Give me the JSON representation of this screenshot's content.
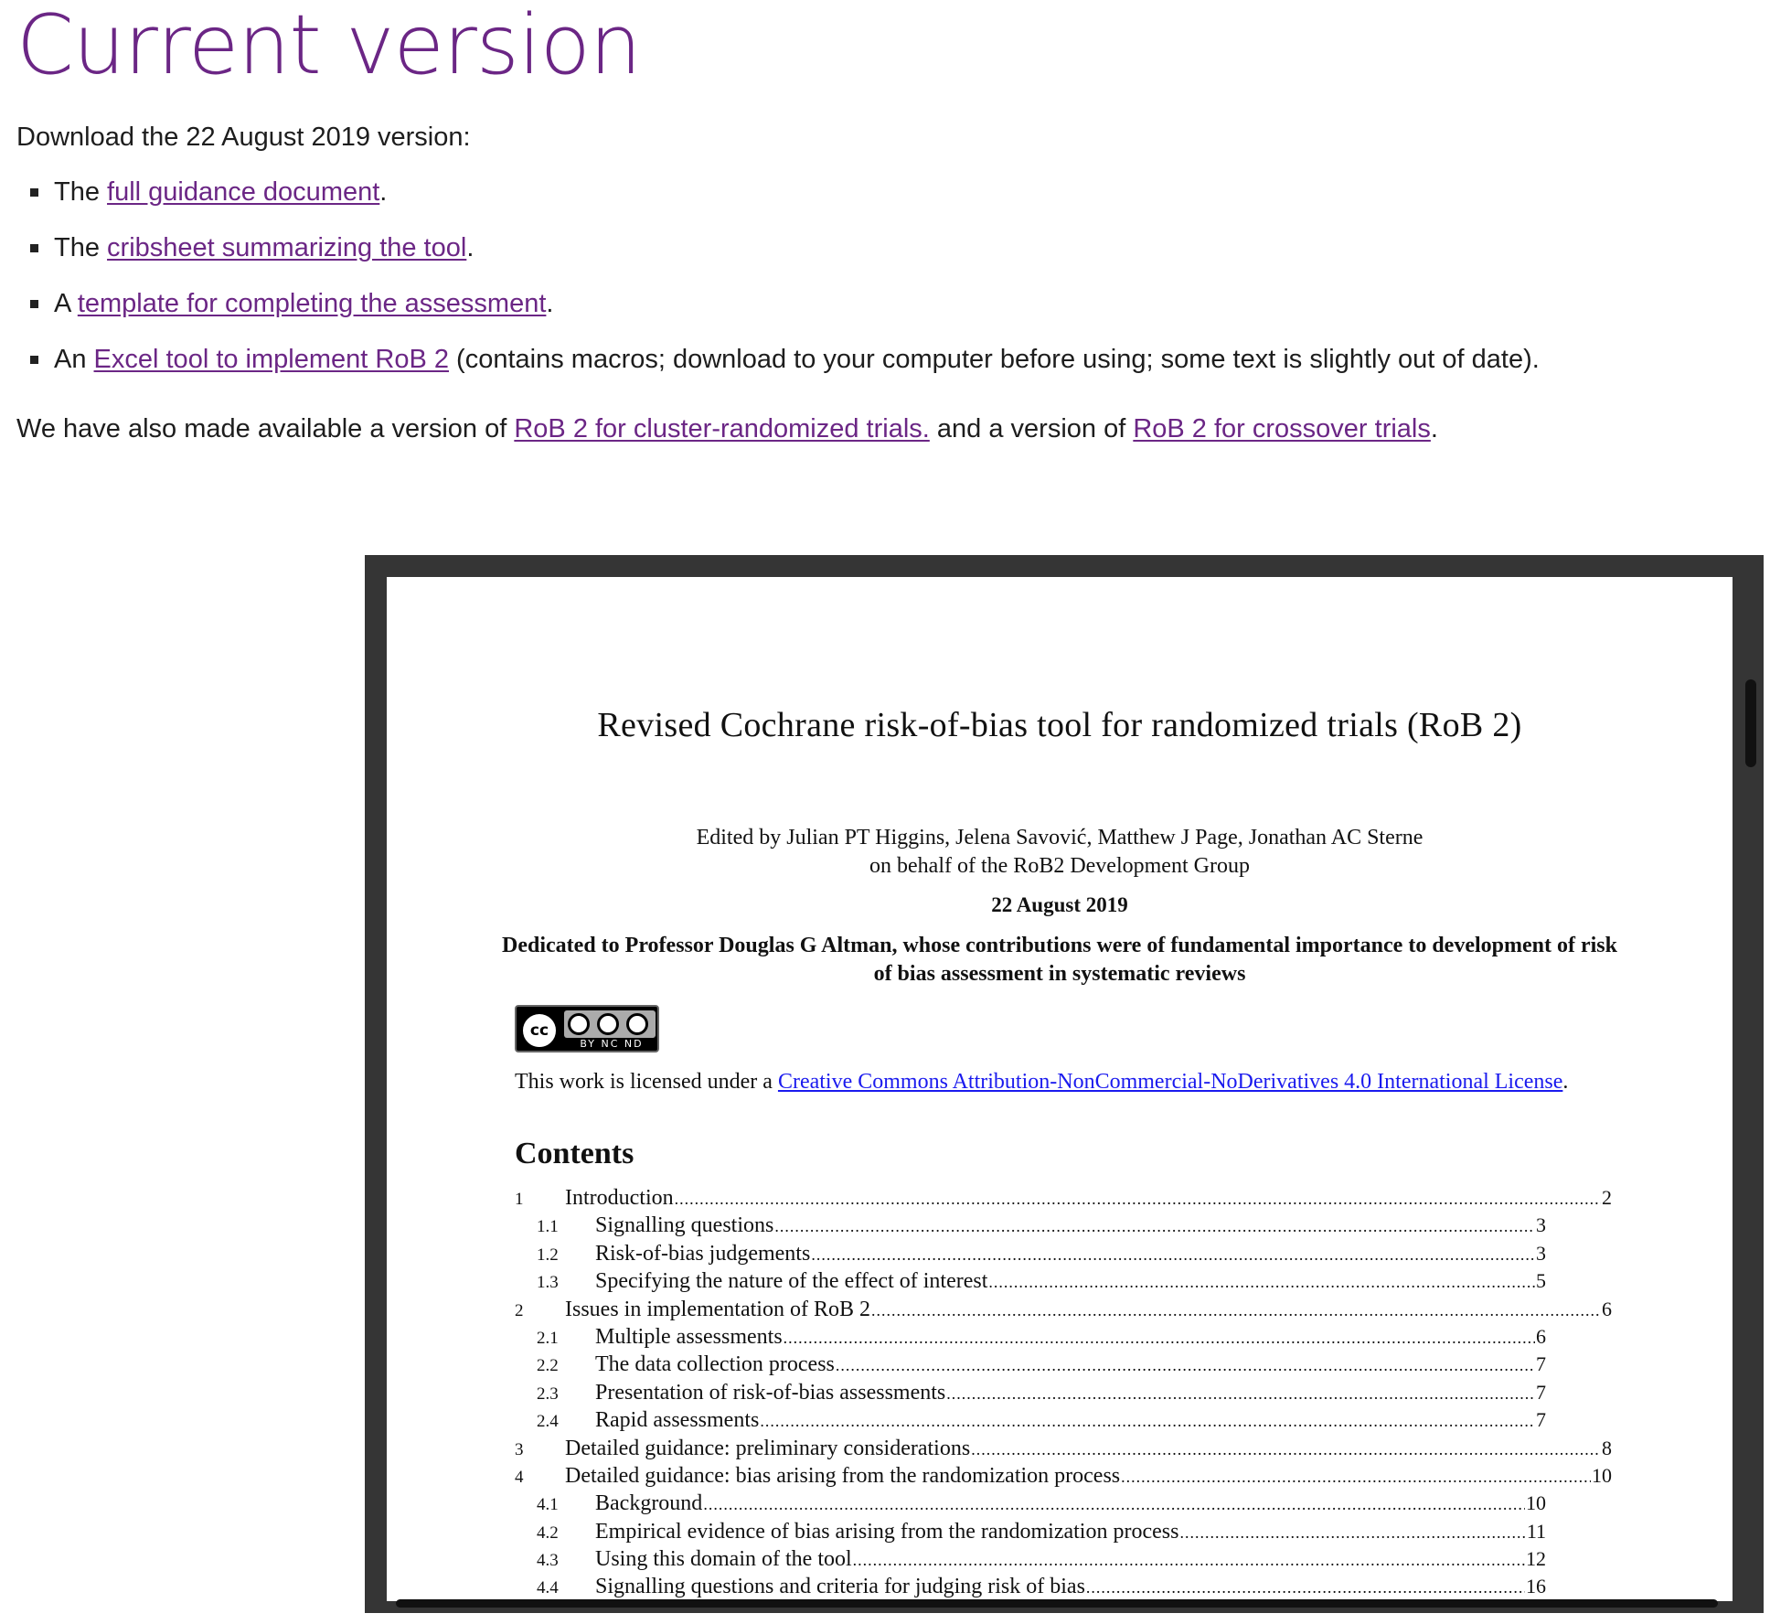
{
  "page": {
    "title": "Current version",
    "intro": "Download the 22 August 2019 version:"
  },
  "downloads": [
    {
      "prefix": "The ",
      "link": "full guidance document",
      "suffix": "."
    },
    {
      "prefix": "The ",
      "link": "cribsheet summarizing the tool",
      "suffix": "."
    },
    {
      "prefix": "A ",
      "link": "template for completing the assessment",
      "suffix": "."
    },
    {
      "prefix": "An ",
      "link": "Excel tool to implement RoB 2",
      "suffix": " (contains macros; download to your computer before using; some text is slightly out of date)."
    }
  ],
  "also": {
    "prefix": "We have also made available a version of ",
    "link1": "RoB 2 for cluster-randomized trials.",
    "middle": " and a version of ",
    "link2": "RoB 2 for crossover trials",
    "suffix": "."
  },
  "pdf": {
    "title": "Revised Cochrane risk-of-bias tool for randomized trials (RoB 2)",
    "editors_line1": "Edited by Julian PT Higgins, Jelena Savović, Matthew J Page, Jonathan AC Sterne",
    "editors_line2": "on behalf of the RoB2 Development Group",
    "date": "22 August 2019",
    "dedication": "Dedicated to Professor Douglas G Altman, whose contributions were of fundamental importance to development of risk of bias assessment in systematic reviews",
    "cc_badge": {
      "cc": "cc",
      "terms": "BY NC ND"
    },
    "license_prefix": "This work is licensed under a ",
    "license_link": "Creative Commons Attribution-NonCommercial-NoDerivatives 4.0 International License",
    "license_suffix": ".",
    "contents_heading": "Contents",
    "toc": [
      {
        "num": "1",
        "title": "Introduction",
        "page": "2",
        "level": 1
      },
      {
        "num": "1.1",
        "title": "Signalling questions",
        "page": "3",
        "level": 2
      },
      {
        "num": "1.2",
        "title": "Risk-of-bias judgements",
        "page": "3",
        "level": 2
      },
      {
        "num": "1.3",
        "title": "Specifying the nature of the effect of interest",
        "page": "5",
        "level": 2
      },
      {
        "num": "2",
        "title": "Issues in implementation of RoB 2",
        "page": "6",
        "level": 1
      },
      {
        "num": "2.1",
        "title": "Multiple assessments",
        "page": "6",
        "level": 2
      },
      {
        "num": "2.2",
        "title": "The data collection process",
        "page": "7",
        "level": 2
      },
      {
        "num": "2.3",
        "title": "Presentation of risk-of-bias assessments",
        "page": "7",
        "level": 2
      },
      {
        "num": "2.4",
        "title": "Rapid assessments",
        "page": "7",
        "level": 2
      },
      {
        "num": "3",
        "title": "Detailed guidance: preliminary considerations",
        "page": "8",
        "level": 1
      },
      {
        "num": "4",
        "title": "Detailed guidance: bias arising from the randomization process",
        "page": "10",
        "level": 1
      },
      {
        "num": "4.1",
        "title": "Background",
        "page": "10",
        "level": 2
      },
      {
        "num": "4.2",
        "title": "Empirical evidence of bias arising from the randomization process",
        "page": "11",
        "level": 2
      },
      {
        "num": "4.3",
        "title": "Using this domain of the tool",
        "page": "12",
        "level": 2
      },
      {
        "num": "4.4",
        "title": "Signalling questions and criteria for judging risk of bias",
        "page": "16",
        "level": 2
      }
    ]
  },
  "colors": {
    "brand_purple": "#6b2685",
    "viewer_frame": "#353535",
    "pdf_link_blue": "#1a1aee"
  }
}
